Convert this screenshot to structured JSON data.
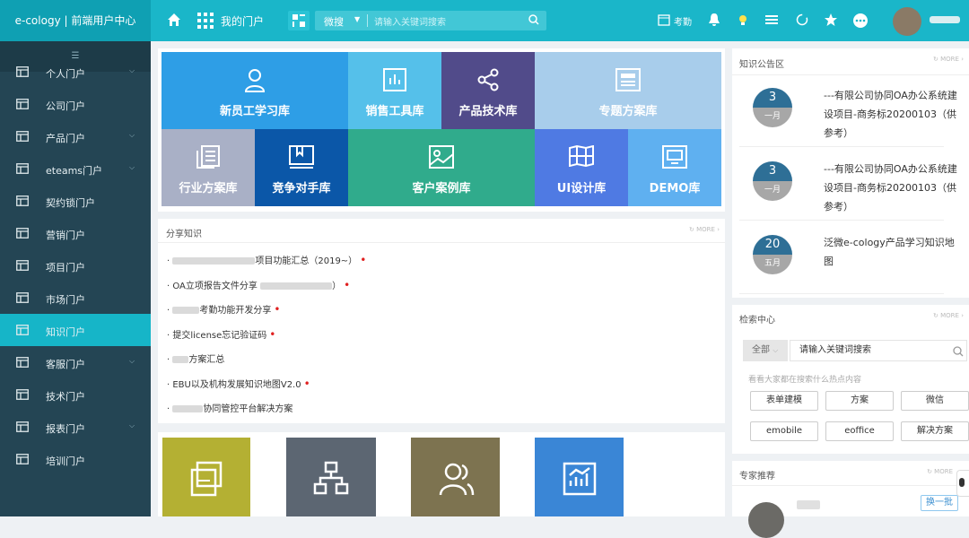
{
  "header": {
    "brand": "e-cology | 前端用户中心",
    "my_portal": "我的门户",
    "search_scope": "微搜",
    "search_placeholder": "请输入关键词搜索",
    "attendance": "考勤"
  },
  "sidebar": {
    "items": [
      {
        "label": "个人门户",
        "chevron": true
      },
      {
        "label": "公司门户",
        "chevron": false
      },
      {
        "label": "产品门户",
        "chevron": true
      },
      {
        "label": "eteams门户",
        "chevron": true
      },
      {
        "label": "契约锁门户",
        "chevron": false
      },
      {
        "label": "营销门户",
        "chevron": false
      },
      {
        "label": "项目门户",
        "chevron": false
      },
      {
        "label": "市场门户",
        "chevron": false
      },
      {
        "label": "知识门户",
        "chevron": false,
        "active": true
      },
      {
        "label": "客服门户",
        "chevron": true
      },
      {
        "label": "技术门户",
        "chevron": false
      },
      {
        "label": "报表门户",
        "chevron": true
      },
      {
        "label": "培训门户",
        "chevron": false
      }
    ]
  },
  "tiles": [
    {
      "label": "新员工学习库",
      "color": "#2e9ee6"
    },
    {
      "label": "销售工具库",
      "color": "#55c0ea"
    },
    {
      "label": "产品技术库",
      "color": "#514b8a"
    },
    {
      "label": "专题方案库",
      "color": "#a8cdeb"
    },
    {
      "label": "行业方案库",
      "color": "#a9b0c6"
    },
    {
      "label": "竞争对手库",
      "color": "#0b57a8"
    },
    {
      "label": "客户案例库",
      "color": "#30ab8c"
    },
    {
      "label": "UI设计库",
      "color": "#4f7ae3"
    },
    {
      "label": "DEMO库",
      "color": "#5fb0f0"
    }
  ],
  "share": {
    "title": "分享知识",
    "more": "MORE",
    "items": [
      {
        "text": "项目功能汇总（2019~）",
        "new": true
      },
      {
        "text": "OA立项报告文件分享",
        "suffix": "）",
        "new": true
      },
      {
        "text": "考勤功能开发分享",
        "new": true
      },
      {
        "text": "提交license忘记验证码",
        "new": true
      },
      {
        "text": "方案汇总",
        "new": false
      },
      {
        "text": "EBU以及机构发展知识地图V2.0",
        "new": true
      },
      {
        "text": "协同管控平台解决方案",
        "new": false
      }
    ]
  },
  "notice": {
    "title": "知识公告区",
    "more": "MORE",
    "items": [
      {
        "day": "3",
        "month": "一月",
        "text": "---有限公司协同OA办公系统建设项目-商务标20200103（供参考）"
      },
      {
        "day": "3",
        "month": "一月",
        "text": "---有限公司协同OA办公系统建设项目-商务标20200103（供参考）"
      },
      {
        "day": "20",
        "month": "五月",
        "text": "泛微e-cology产品学习知识地图"
      }
    ]
  },
  "search_center": {
    "title": "检索中心",
    "more": "MORE",
    "scope": "全部",
    "value": "请输入关键词搜索",
    "hint": "看看大家都在搜索什么热点内容",
    "tags": [
      "表单建模",
      "方案",
      "微信",
      "emobile",
      "eoffice",
      "解决方案"
    ]
  },
  "expert": {
    "title": "专家推荐",
    "more": "MORE",
    "change": "换一批"
  },
  "image_tiles": [
    {
      "color": "#b4b033",
      "icon": "document-stack-icon"
    },
    {
      "color": "#5c6672",
      "icon": "org-chart-icon"
    },
    {
      "color": "#7d7350",
      "icon": "people-icon"
    },
    {
      "color": "#3a86d6",
      "icon": "chart-board-icon"
    }
  ]
}
